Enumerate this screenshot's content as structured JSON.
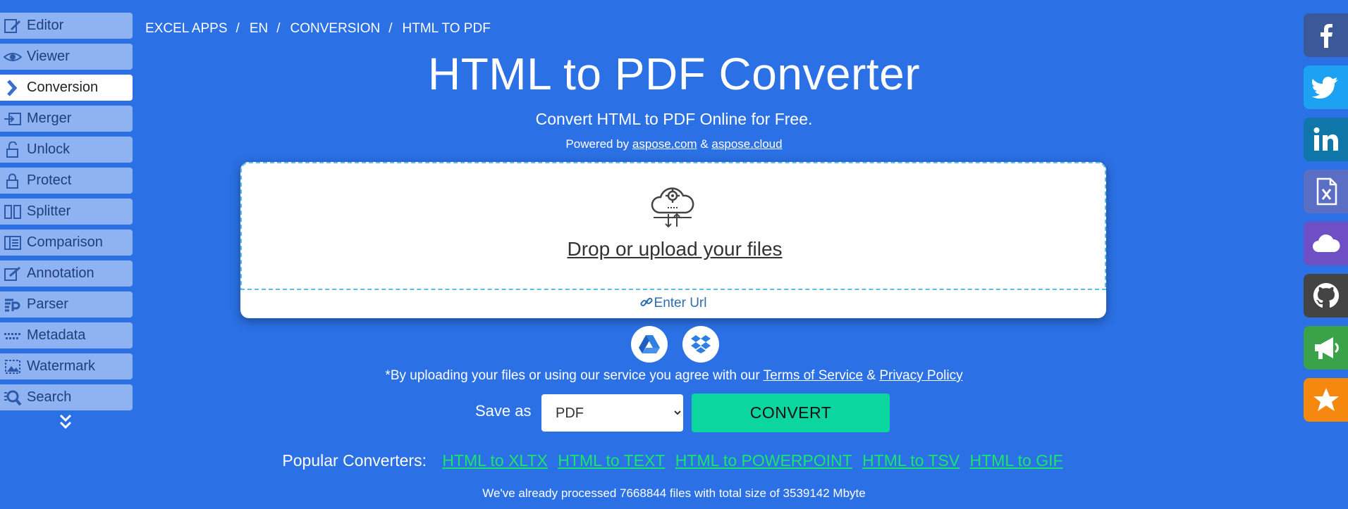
{
  "sidebar": {
    "items": [
      {
        "label": "Editor",
        "icon": "edit-icon",
        "active": false
      },
      {
        "label": "Viewer",
        "icon": "eye-icon",
        "active": false
      },
      {
        "label": "Conversion",
        "icon": "chevron-right-icon",
        "active": true
      },
      {
        "label": "Merger",
        "icon": "merge-icon",
        "active": false
      },
      {
        "label": "Unlock",
        "icon": "unlock-icon",
        "active": false
      },
      {
        "label": "Protect",
        "icon": "lock-icon",
        "active": false
      },
      {
        "label": "Splitter",
        "icon": "split-icon",
        "active": false
      },
      {
        "label": "Comparison",
        "icon": "compare-icon",
        "active": false
      },
      {
        "label": "Annotation",
        "icon": "annotation-icon",
        "active": false
      },
      {
        "label": "Parser",
        "icon": "parser-icon",
        "active": false
      },
      {
        "label": "Metadata",
        "icon": "metadata-icon",
        "active": false
      },
      {
        "label": "Watermark",
        "icon": "watermark-icon",
        "active": false
      },
      {
        "label": "Search",
        "icon": "search-icon",
        "active": false
      }
    ]
  },
  "breadcrumb": [
    "EXCEL APPS",
    "EN",
    "CONVERSION",
    "HTML TO PDF"
  ],
  "title": "HTML to PDF Converter",
  "subtitle": "Convert HTML to PDF Online for Free.",
  "powered": {
    "prefix": "Powered by",
    "link1": "aspose.com",
    "amp": "&",
    "link2": "aspose.cloud"
  },
  "upload": {
    "drop_text": "Drop or upload your files",
    "enter_url": "Enter Url"
  },
  "terms": {
    "prefix": "*By uploading your files or using our service you agree with our",
    "tos": "Terms of Service",
    "amp": "&",
    "privacy": "Privacy Policy"
  },
  "save": {
    "label": "Save as",
    "selected": "PDF",
    "convert": "CONVERT"
  },
  "popular": {
    "label": "Popular Converters:",
    "links": [
      "HTML to XLTX",
      "HTML to TEXT",
      "HTML to POWERPOINT",
      "HTML to TSV",
      "HTML to GIF"
    ]
  },
  "processed": "We've already processed 7668844 files with total size of 3539142 Mbyte",
  "social": [
    {
      "icon": "facebook-icon",
      "color": "#3b5998"
    },
    {
      "icon": "twitter-icon",
      "color": "#1da1f2"
    },
    {
      "icon": "linkedin-icon",
      "color": "#0e76a8"
    },
    {
      "icon": "excel-file-icon",
      "color": "#5a6fc4"
    },
    {
      "icon": "cloud-icon",
      "color": "#6f4fc4"
    },
    {
      "icon": "github-icon",
      "color": "#444444"
    },
    {
      "icon": "megaphone-icon",
      "color": "#3aa34a"
    },
    {
      "icon": "star-icon",
      "color": "#f6870f"
    }
  ]
}
